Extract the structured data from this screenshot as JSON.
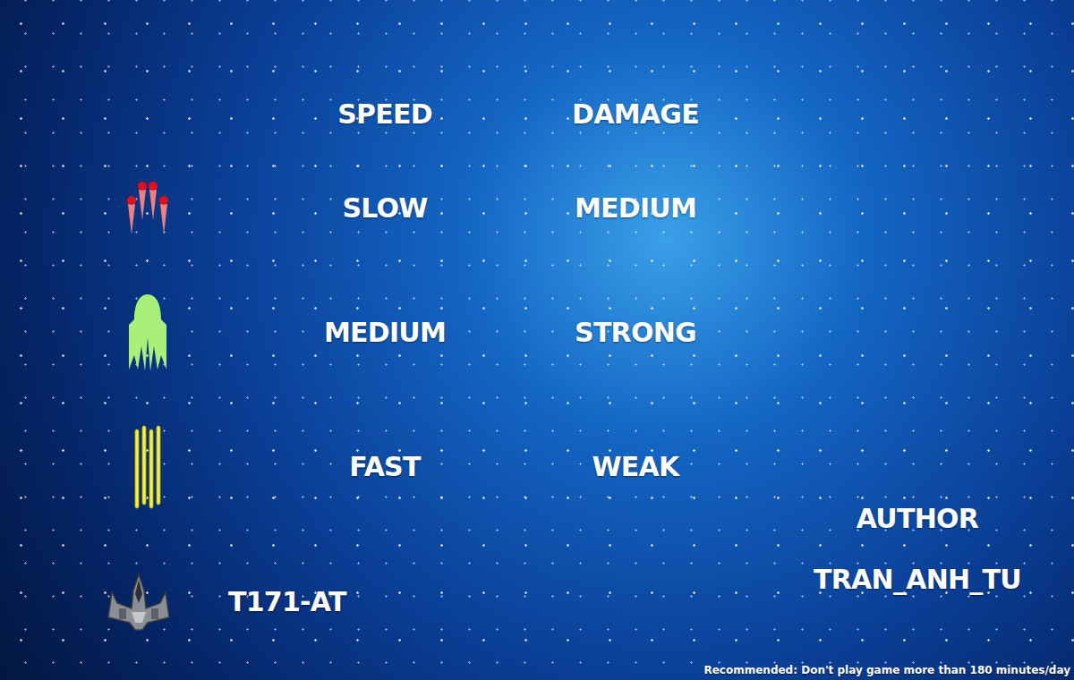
{
  "table": {
    "columns": [
      "SPEED",
      "DAMAGE"
    ],
    "rows": [
      {
        "kind": "spread",
        "color": "#f08080",
        "speed": "SLOW",
        "damage": "MEDIUM"
      },
      {
        "kind": "plasma",
        "color": "#a8f07a",
        "speed": "MEDIUM",
        "damage": "STRONG"
      },
      {
        "kind": "laser",
        "color": "#f4f04a",
        "speed": "FAST",
        "damage": "WEAK"
      }
    ]
  },
  "player": {
    "name": "T171-AT"
  },
  "author": {
    "label": "AUTHOR",
    "name": "TRAN_ANH_TU"
  },
  "footer": "Recommended: Don't play game more than 180 minutes/day"
}
